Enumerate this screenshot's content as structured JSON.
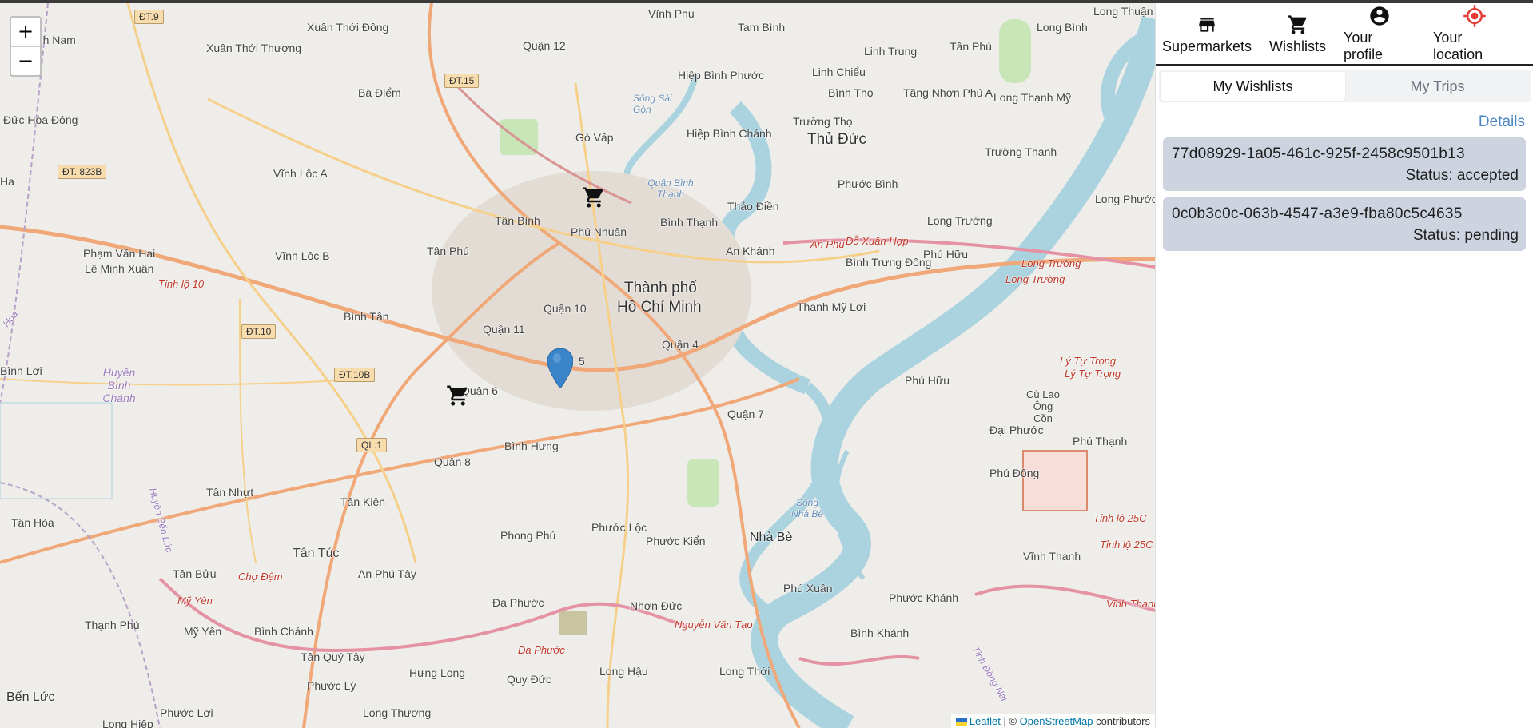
{
  "map": {
    "zoom_in_label": "+",
    "zoom_out_label": "−",
    "labels": {
      "xuan_thoi_dong": "Xuân Thới Đông",
      "xuan_thoi_thuong": "Xuân Thới Thượng",
      "quan12": "Quận 12",
      "tam_binh": "Tam Bình",
      "vinh_phu": "Vĩnh Phú",
      "long_binh": "Long Bình",
      "long_thuan": "Long Thuận",
      "hiep_binh_phuoc": "Hiệp Bình Phước",
      "linh_trung": "Linh Trung",
      "tan_phu_top": "Tân Phú",
      "ba_diem": "Bà Điểm",
      "duc_hoa_dong": "Đức Hòa Đông",
      "linh_chieu": "Linh Chiểu",
      "binh_tho": "Bình Thọ",
      "tang_nhon_phu_a": "Tăng Nhơn Phú A",
      "long_thanh_my": "Long Thạnh Mỹ",
      "go_vap": "Gò Vấp",
      "hiep_binh_chanh": "Hiệp Bình Chánh",
      "truong_tho": "Trường Thọ",
      "thu_duc": "Thủ Đức",
      "truong_thanh": "Trường Thạnh",
      "vinh_loc_a": "Vĩnh Lộc A",
      "tan_binh": "Tân Bình",
      "phu_nhuan": "Phú Nhuận",
      "binh_thanh": "Bình Thạnh",
      "thao_dien": "Thảo Điền",
      "phuoc_binh": "Phước Bình",
      "long_truong": "Long Trường",
      "long_phuoc": "Long Phước",
      "pham_van_hai": "Phạm Văn Hai",
      "le_minh_xuan": "Lê Minh Xuân",
      "vinh_loc_b": "Vĩnh Lộc B",
      "tan_phu": "Tân Phú",
      "an_khanh": "An Khánh",
      "binh_trung_dong": "Bình Trưng Đông",
      "phu_huu_top": "Phú Hữu",
      "tp_hcm_1": "Thành phố",
      "tp_hcm_2": "Hồ Chí Minh",
      "binh_tan": "Bình Tân",
      "quan11": "Quận 11",
      "quan10": "Quận 10",
      "thanh_my_loi": "Thạnh Mỹ Lợi",
      "quan4": "Quận 4",
      "quan5_num": "5",
      "binh_loi": "Bình Lợi",
      "huyen_binh_chanh": "Huyện Bình Chánh",
      "quan6": "Quận 6",
      "phu_huu": "Phú Hữu",
      "quan7": "Quận 7",
      "cu_lao_ong_con": "Cù Lao Ông Cồn",
      "dai_phuoc": "Đại Phước",
      "phu_thanh": "Phú Thạnh",
      "binh_hung": "Bình Hưng",
      "quan8": "Quận 8",
      "tan_nhut": "Tân Nhựt",
      "tan_kien": "Tân Kiên",
      "tan_hoa": "Tân Hòa",
      "phu_dong": "Phú Đông",
      "phong_phu": "Phong Phú",
      "phuoc_loc": "Phước Lộc",
      "phuoc_kien": "Phước Kiển",
      "nha_be": "Nhà Bè",
      "vinh_thanh": "Vĩnh Thanh",
      "tan_tuc": "Tân Túc",
      "tan_buu": "Tân Bửu",
      "an_phu_tay": "An Phú Tây",
      "phu_xuan": "Phú Xuân",
      "phuoc_khanh": "Phước Khánh",
      "thanh_phu": "Thạnh Phú",
      "my_yen": "Mỹ Yên",
      "binh_chanh": "Bình Chánh",
      "da_phuoc": "Đa Phước",
      "nhon_duc": "Nhơn Đức",
      "binh_khanh": "Bình Khánh",
      "tan_quy_tay": "Tân Quý Tây",
      "hung_long": "Hưng Long",
      "quy_duc": "Quy Đức",
      "long_hau": "Long Hậu",
      "long_thoi": "Long Thới",
      "ben_luc": "Bến Lức",
      "phuoc_loi": "Phước Lợi",
      "long_thuong": "Long Thượng",
      "long_hiep": "Long Hiệp",
      "phuoc_ly": "Phước Lý",
      "anh_nam": "anh Nam",
      "ha": "Ha",
      "song_sai_gon": "Sông Sài Gòn",
      "quan_binh_thanh": "Quận Bình Thạnh",
      "song_nha_be": "Sông Nhà Bè"
    },
    "road_labels": {
      "an_phu": "An Phú",
      "do_xuan_hop": "Đỗ Xuân Hợp",
      "long_truong_1": "Long Trường",
      "long_truong_2": "Long Trường",
      "ly_tu_trong_1": "Lý Tự Trọng",
      "ly_tu_trong_2": "Lý Tự Trọng",
      "tinh_lo_10": "Tỉnh lộ 10",
      "tinh_lo_25c_1": "Tỉnh lộ 25C",
      "tinh_lo_25c_2": "Tỉnh lộ 25C",
      "vinh_thanh_road": "Vĩnh Thanh",
      "cho_dem": "Chợ Đệm",
      "my_yen_road": "Mỹ Yên",
      "nguyen_van_tao": "Nguyễn Văn Tạo",
      "da_phuoc_road": "Đa Phước",
      "huyen_ben_luc": "Huyện Bến Lức",
      "tinh_dong_nai": "Tỉnh Đồng Nai",
      "hoa": "Hòa"
    },
    "shields": {
      "dt9": "ĐT.9",
      "dt15": "ĐT.15",
      "dt823b": "ĐT. 823B",
      "dt10": "ĐT.10",
      "dt10b": "ĐT.10B",
      "ql1": "QL.1"
    },
    "attribution": {
      "leaflet": "Leaflet",
      "sep": " | © ",
      "osm": "OpenStreetMap",
      "contributors": " contributors"
    }
  },
  "nav": {
    "items": [
      {
        "label": "Supermarkets",
        "icon": "store-icon"
      },
      {
        "label": "Wishlists",
        "icon": "cart-icon"
      },
      {
        "label": "Your profile",
        "icon": "account-circle-icon"
      },
      {
        "label": "Your location",
        "icon": "gps-target-icon"
      }
    ],
    "location_color": "#e53935"
  },
  "tabs": {
    "wishlists": "My Wishlists",
    "trips": "My Trips"
  },
  "details_label": "Details",
  "wishlists": [
    {
      "id": "77d08929-1a05-461c-925f-2458c9501b13",
      "status": "Status: accepted"
    },
    {
      "id": "0c0b3c0c-063b-4547-a3e9-fba80c5c4635",
      "status": "Status: pending"
    }
  ],
  "colors": {
    "card_bg": "#cdd4e0",
    "details_link": "#4a86c5",
    "marker": "#3a84c9"
  }
}
